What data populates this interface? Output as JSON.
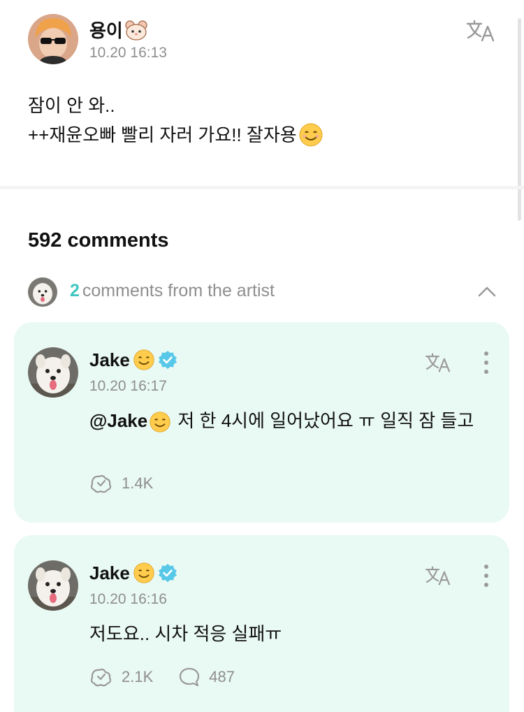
{
  "post": {
    "author": "용이",
    "timestamp": "10.20 16:13",
    "translate_icon": "translate-icon",
    "lines": [
      "잠이 안 와..",
      "++재윤오빠 빨리 자러 가요!! 잘자용"
    ]
  },
  "comments_section": {
    "title": "592 comments",
    "artist_count": "2",
    "artist_label": "comments from the artist"
  },
  "comments": [
    {
      "author": "Jake",
      "timestamp": "10.20 16:17",
      "mention": "@Jake",
      "text": " 저 한 4시에 일어났어요 ㅠ 일직 잠 들고",
      "likes": "1.4K"
    },
    {
      "author": "Jake",
      "timestamp": "10.20 16:16",
      "text": "저도요.. 시차 적응 실패ㅠ",
      "likes": "2.1K",
      "replies": "487"
    }
  ],
  "colors": {
    "accent": "#3fc6c0",
    "card_background": "#e9f9f4",
    "muted_text": "#8e8e8e",
    "verified_badge": "#57c8e8"
  }
}
